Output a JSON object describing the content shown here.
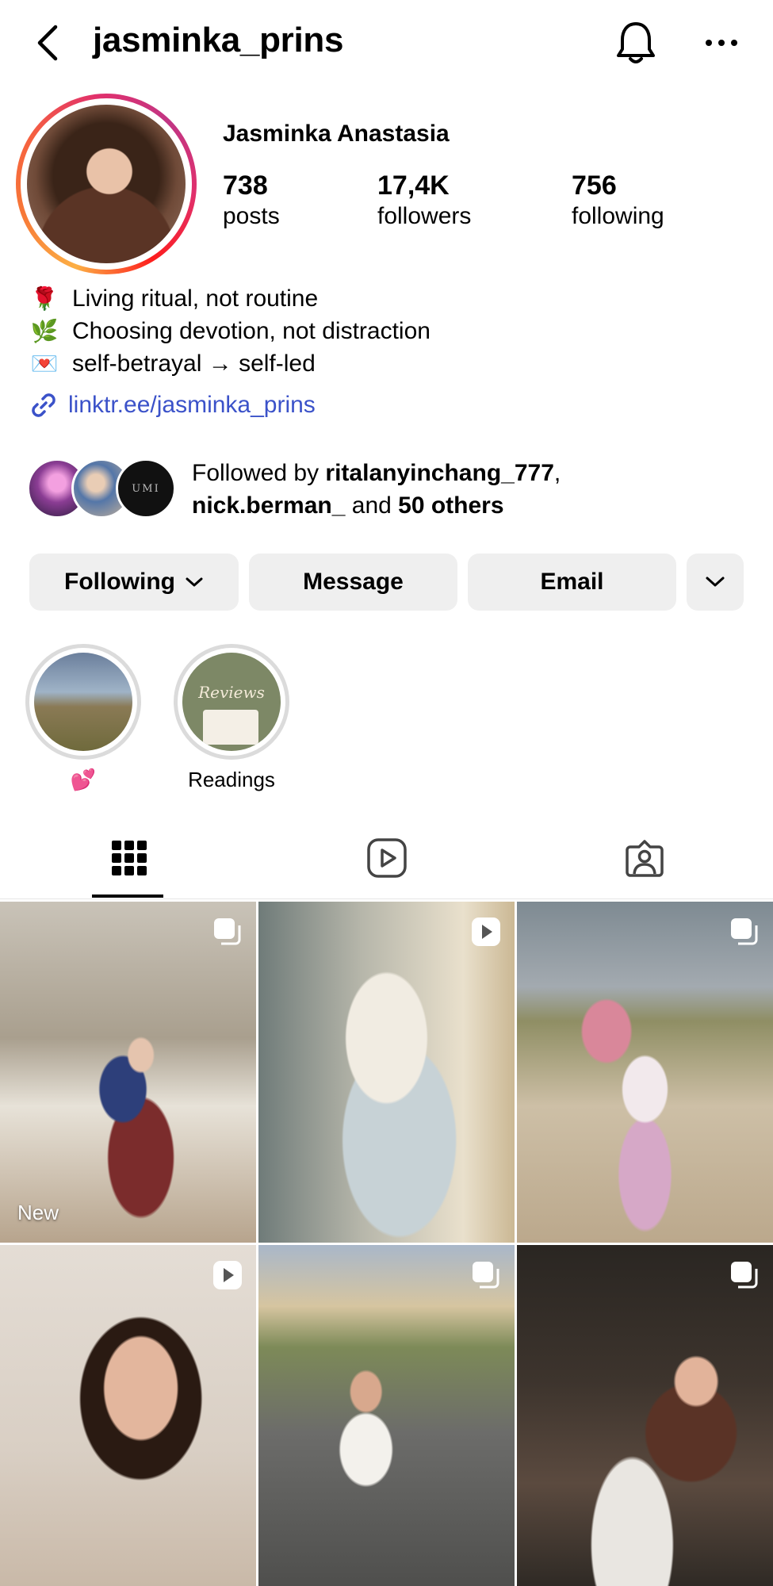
{
  "header": {
    "username": "jasminka_prins"
  },
  "profile": {
    "full_name": "Jasminka Anastasia",
    "stats": {
      "posts_count": "738",
      "posts_label": "posts",
      "followers_count": "17,4K",
      "followers_label": "followers",
      "following_count": "756",
      "following_label": "following"
    },
    "bio": [
      {
        "emoji": "🌹",
        "text": "Living ritual, not routine"
      },
      {
        "emoji": "🌿",
        "text": "Choosing devotion, not distraction"
      },
      {
        "emoji": "💌",
        "text": "self-betrayal → self-led"
      }
    ],
    "link": "linktr.ee/jasminka_prins",
    "followed_by": {
      "prefix": "Followed by ",
      "user1": "ritalanyinchang_777",
      "separator": ",",
      "user2": "nick.berman_",
      "and": " and ",
      "others": "50 others"
    }
  },
  "actions": {
    "following": "Following",
    "message": "Message",
    "email": "Email"
  },
  "highlights": [
    {
      "label": "💕"
    },
    {
      "label": "Readings"
    }
  ],
  "grid": {
    "new_label": "New"
  },
  "colors": {
    "link": "#3b52c9",
    "button_bg": "#efefef",
    "ring_gradient": [
      "#fcaf45",
      "#f56040",
      "#e1306c",
      "#c13584"
    ]
  }
}
